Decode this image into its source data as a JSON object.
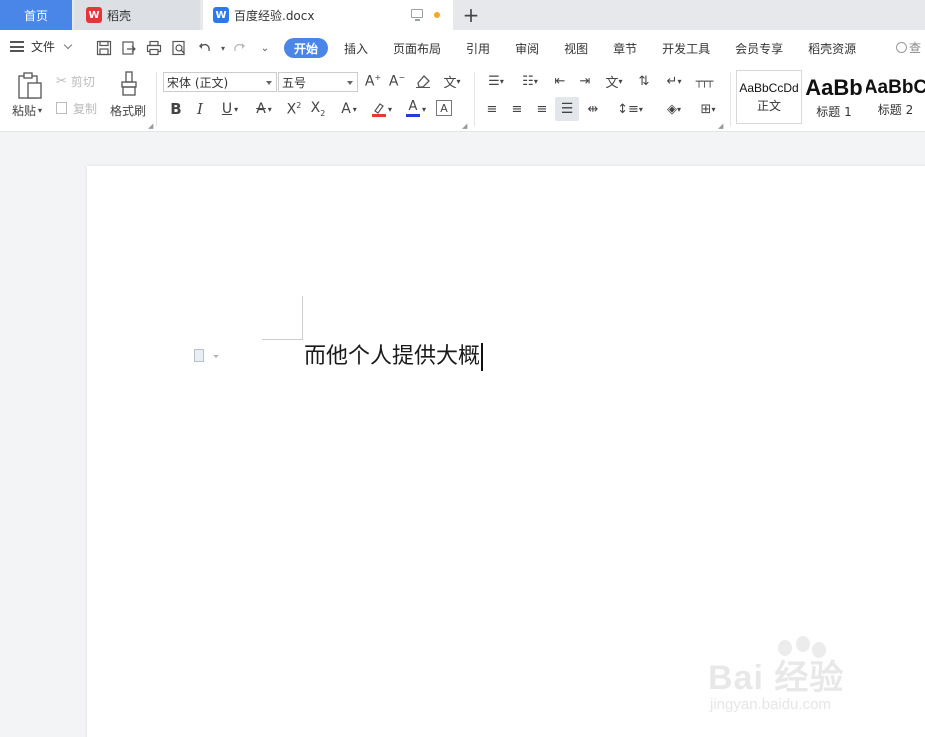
{
  "tabs": {
    "home": "首页",
    "wps": "稻壳",
    "doc": "百度经验.docx",
    "wps_icon": "wps-icon",
    "doc_icon": "word-doc-icon"
  },
  "menu": {
    "file": "文件",
    "tabs": [
      "开始",
      "插入",
      "页面布局",
      "引用",
      "审阅",
      "视图",
      "章节",
      "开发工具",
      "会员专享",
      "稻壳资源"
    ],
    "active_tab": "开始",
    "search": "查"
  },
  "ribbon": {
    "paste": "粘贴",
    "cut": "剪切",
    "copy": "复制",
    "format_painter": "格式刷",
    "font_name": "宋体 (正文)",
    "font_size": "五号",
    "styles": [
      {
        "preview": "AaBbCcDd",
        "name": "正文"
      },
      {
        "preview": "AaBb",
        "name": "标题 1"
      },
      {
        "preview": "AaBbC",
        "name": "标题 2"
      }
    ]
  },
  "document": {
    "text": "而他个人提供大概"
  },
  "watermark": {
    "main": "Bai 经验",
    "sub": "jingyan.baidu.com"
  },
  "colors": {
    "accent": "#4a86e8",
    "font_color_underline": "#1f3fd6",
    "highlight_underline": "#e53935"
  }
}
